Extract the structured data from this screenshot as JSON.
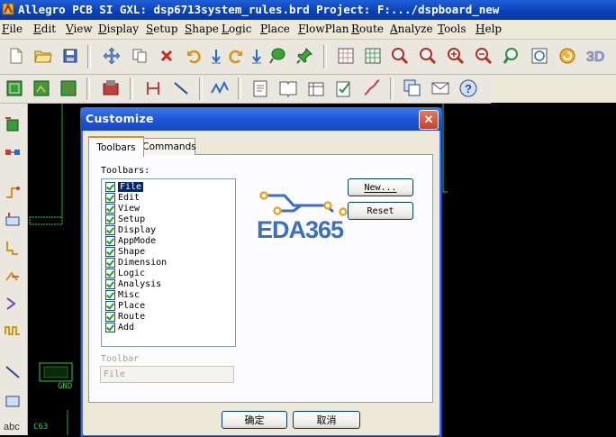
{
  "window": {
    "title": "Allegro PCB SI GXL: dsp6713system_rules.brd  Project: F:.../dspboard_new"
  },
  "menu": [
    "File",
    "Edit",
    "View",
    "Display",
    "Setup",
    "Shape",
    "Logic",
    "Place",
    "FlowPlan",
    "Route",
    "Analyze",
    "Tools",
    "Help"
  ],
  "toolbar1_icons": [
    "new-file-icon",
    "open-folder-icon",
    "save-icon",
    "move-icon",
    "copy-icon",
    "delete-icon",
    "undo-icon",
    "arrow-down-icon",
    "redo-icon",
    "arrow-down-icon",
    "shove-icon",
    "pin-icon",
    "grid-icon",
    "grid2-icon",
    "zoom-fit-icon",
    "zoom-in-icon",
    "zoom-out-icon",
    "zoom-window-icon",
    "zoom-prev-icon",
    "zoom-world-icon",
    "refresh-icon",
    "3d-icon"
  ],
  "toolbar2_icons": [
    "layer1-icon",
    "layer2-icon",
    "layer3-icon",
    "drc-icon",
    "dim-icon",
    "line-icon",
    "wave-icon",
    "report1-icon",
    "report2-icon",
    "report3-icon",
    "check-icon",
    "tune-icon",
    "copy-window-icon",
    "mail-icon",
    "help-icon"
  ],
  "dialog": {
    "title": "Customize",
    "tabs": [
      "Toolbars",
      "Commands"
    ],
    "toolbars_label": "Toolbars:",
    "toolbars": [
      {
        "label": "File",
        "checked": true,
        "selected": true
      },
      {
        "label": "Edit",
        "checked": true
      },
      {
        "label": "View",
        "checked": true
      },
      {
        "label": "Setup",
        "checked": true
      },
      {
        "label": "Display",
        "checked": true
      },
      {
        "label": "AppMode",
        "checked": true
      },
      {
        "label": "Shape",
        "checked": true
      },
      {
        "label": "Dimension",
        "checked": true
      },
      {
        "label": "Logic",
        "checked": true
      },
      {
        "label": "Analysis",
        "checked": true
      },
      {
        "label": "Misc",
        "checked": true
      },
      {
        "label": "Place",
        "checked": true
      },
      {
        "label": "Route",
        "checked": true
      },
      {
        "label": "Add",
        "checked": true
      }
    ],
    "toolbar_name_label": "Toolbar",
    "toolbar_name_value": "File",
    "new_button": "New...",
    "reset_button": "Reset",
    "ok_button": "确定",
    "cancel_button": "取消",
    "logo_text": "EDA365"
  },
  "canvas": {
    "labels": [
      "GND",
      "C63"
    ]
  },
  "colors": {
    "titlebar": "#0a3fb5",
    "dialog_title": "#1d55d4",
    "logo_blue": "#3b6fc4",
    "logo_orange": "#e8a62a",
    "pcb_green": "#2bcf3a"
  }
}
